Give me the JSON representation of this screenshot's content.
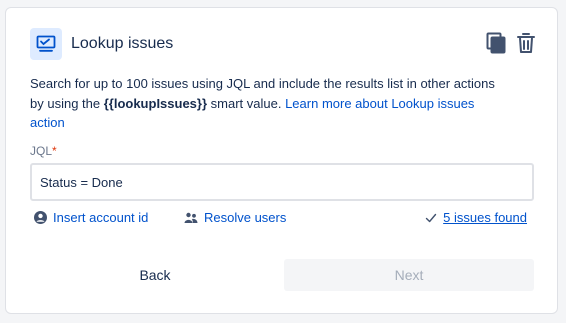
{
  "card": {
    "title": "Lookup issues",
    "icon": "lookup-issues-icon",
    "actions": [
      {
        "icon": "duplicate-icon"
      },
      {
        "icon": "trash-icon"
      }
    ]
  },
  "description": {
    "prefix": "Search for up to 100 issues using JQL and include the results list in other actions by using the ",
    "smart_value": "{{lookupIssues}}",
    "suffix": " smart value. ",
    "link": "Learn more about Lookup issues action"
  },
  "jql": {
    "label": "JQL",
    "required_mark": "*",
    "value": "Status = Done"
  },
  "helpers": {
    "insert_account": "Insert account id",
    "resolve_users": "Resolve users",
    "issues_found": "5 issues found"
  },
  "buttons": {
    "back": "Back",
    "next": "Next",
    "next_disabled": true
  },
  "colors": {
    "link": "#0052cc",
    "text": "#172b4d",
    "subtle": "#6b778c",
    "icon_bg": "#deebff",
    "required": "#de350b",
    "disabled": "#a5adba"
  }
}
